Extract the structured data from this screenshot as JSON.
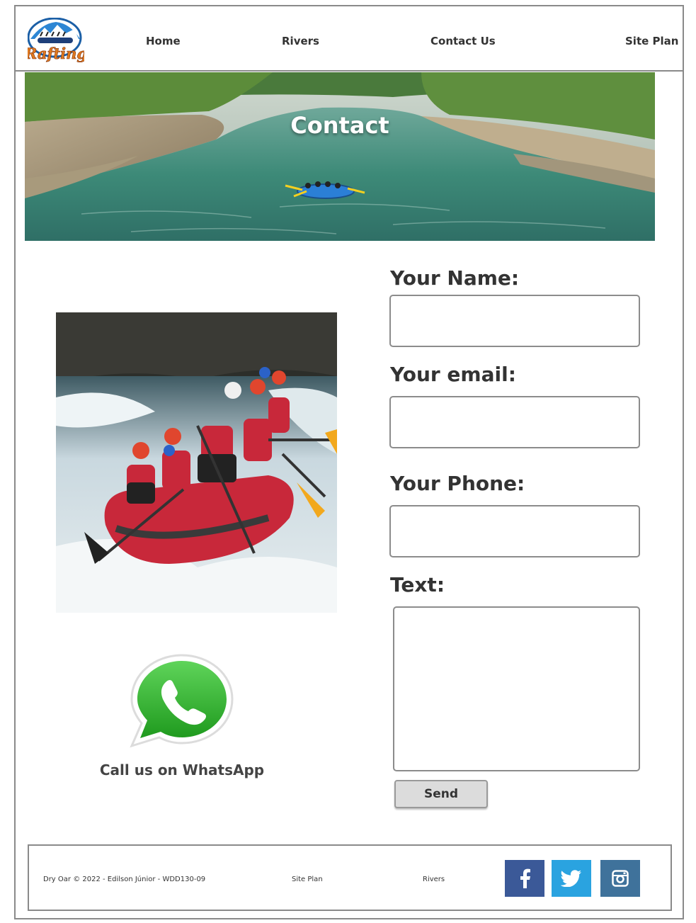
{
  "nav": {
    "home": "Home",
    "rivers": "Rivers",
    "contact": "Contact Us",
    "site_plan": "Site Plan"
  },
  "logo": {
    "text": "Rafting"
  },
  "banner": {
    "title": "Contact"
  },
  "left": {
    "whatsapp_label": "Call us on WhatsApp"
  },
  "form": {
    "name_label": "Your Name:",
    "email_label": "Your email:",
    "phone_label": "Your Phone:",
    "text_label": "Text:",
    "name_value": "",
    "email_value": "",
    "phone_value": "",
    "text_value": "",
    "send_label": "Send"
  },
  "footer": {
    "copyright": "Dry Oar © 2022 - Edilson Júnior - WDD130-09",
    "site_plan_link": "Site Plan",
    "rivers_link": "Rivers",
    "social": [
      {
        "icon": "facebook-icon",
        "color": "#3b5998"
      },
      {
        "icon": "twitter-icon",
        "color": "#2aa3e0"
      },
      {
        "icon": "instagram-icon",
        "color": "#3f729b"
      }
    ]
  }
}
